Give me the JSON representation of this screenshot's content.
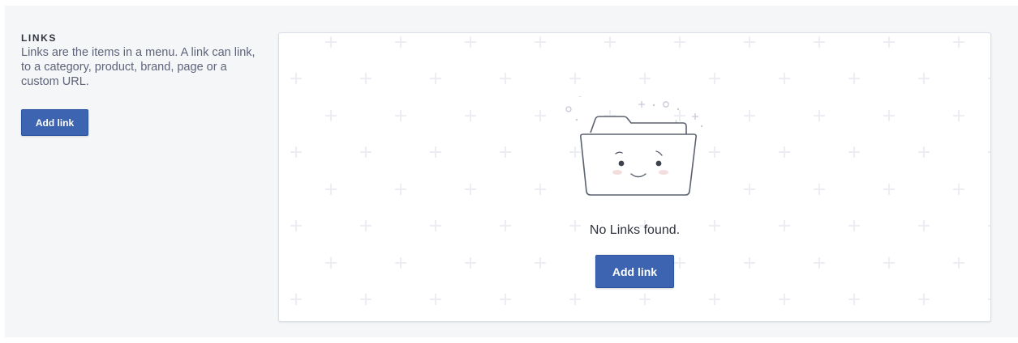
{
  "section": {
    "title": "LINKS",
    "description": "Links are the items in a menu. A link can link, to a category, product, brand, page or a custom URL.",
    "add_button_label": "Add link"
  },
  "empty_state": {
    "icon": "empty-folder-illustration",
    "message": "No Links found.",
    "add_button_label": "Add link"
  },
  "colors": {
    "primary": "#3c64b1",
    "page_background": "#f5f6f8",
    "card_border": "#d9dce9"
  }
}
